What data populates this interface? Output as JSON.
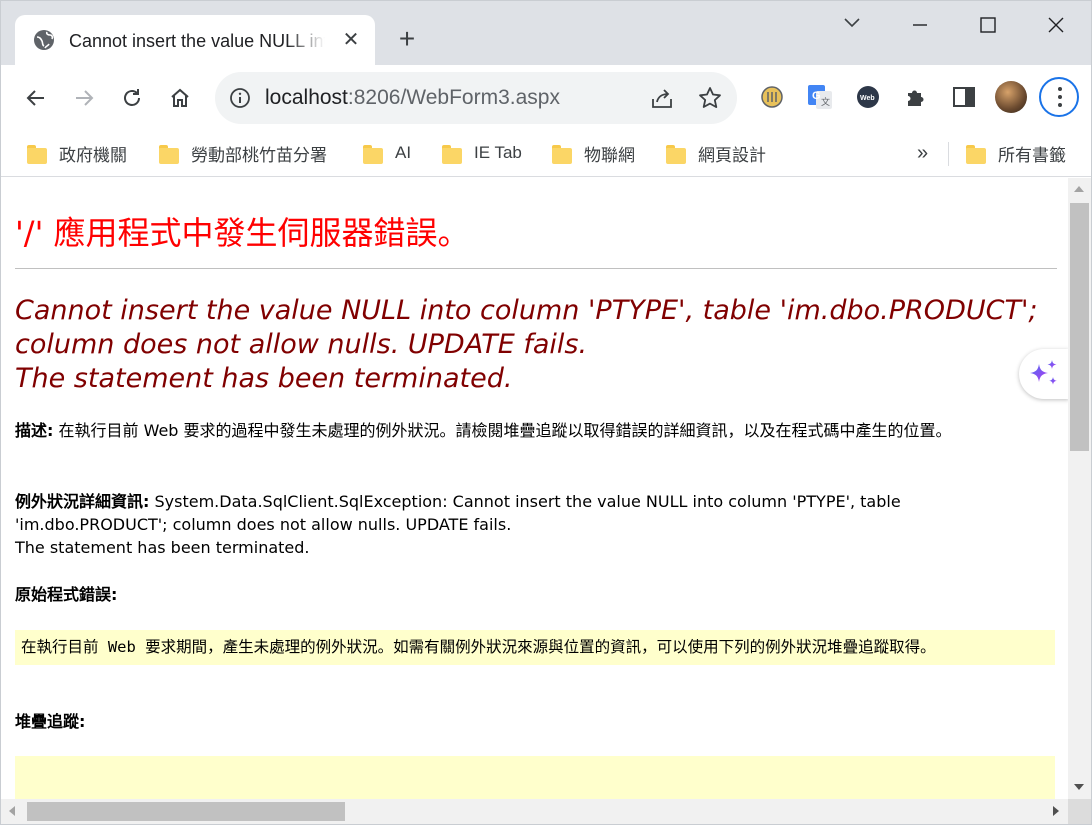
{
  "browser": {
    "tab": {
      "title": "Cannot insert the value NULL into column 'PTYPE', table 'im.dbo.PRODUCT'",
      "close_glyph": "✕",
      "icon": "globe-icon"
    },
    "new_tab_glyph": "+",
    "window_controls": [
      "chevron-down-icon",
      "minimize-icon",
      "maximize-icon",
      "close-icon"
    ],
    "toolbar": {
      "nav": [
        "back-icon",
        "forward-icon",
        "reload-icon",
        "home-icon"
      ],
      "url_host": "localhost",
      "url_rest": ":8206/WebForm3.aspx",
      "omnibox_icons": [
        "info-icon",
        "share-icon",
        "star-icon"
      ],
      "extensions": [
        "ie-tab-extension-icon",
        "google-translate-icon",
        "webchatgpt-icon",
        "puzzle-icon",
        "side-panel-icon"
      ],
      "menu_icon": "kebab-menu-icon"
    },
    "bookmarks": {
      "items": [
        "政府機關",
        "勞動部桃竹苗分署",
        "AI",
        "IE Tab",
        "物聯網",
        "網頁設計"
      ],
      "more_glyph": "»",
      "all_bookmarks": "所有書籤"
    },
    "colors": {
      "tabstrip": "#dee1e6",
      "accent": "#1a73e8",
      "folder": "#fbd666"
    }
  },
  "page": {
    "title": "'/' 應用程式中發生伺服器錯誤。",
    "error_message": "Cannot insert the value NULL into column 'PTYPE', table 'im.dbo.PRODUCT'; column does not allow nulls. UPDATE fails.",
    "error_message_2": "The statement has been terminated.",
    "description_label": "描述:",
    "description_text": " 在執行目前 Web 要求的過程中發生未處理的例外狀況。請檢閱堆疊追蹤以取得錯誤的詳細資訊，以及在程式碼中產生的位置。",
    "exception_label": "例外狀況詳細資訊:",
    "exception_text": " System.Data.SqlClient.SqlException: Cannot insert the value NULL into column 'PTYPE', table 'im.dbo.PRODUCT'; column does not allow nulls. UPDATE fails.",
    "exception_text_2": "The statement has been terminated.",
    "source_error_label": "原始程式錯誤:",
    "source_error_box": "在執行目前 Web 要求期間，產生未處理的例外狀況。如需有關例外狀況來源與位置的資訊，可以使用下列的例外狀況堆疊追蹤取得。",
    "stack_trace_label": "堆疊追蹤:",
    "colors": {
      "title": "#ff0000",
      "error_message": "#800000",
      "code_box": "#ffffcc"
    }
  },
  "floating": {
    "icon": "sparkle-icon"
  }
}
